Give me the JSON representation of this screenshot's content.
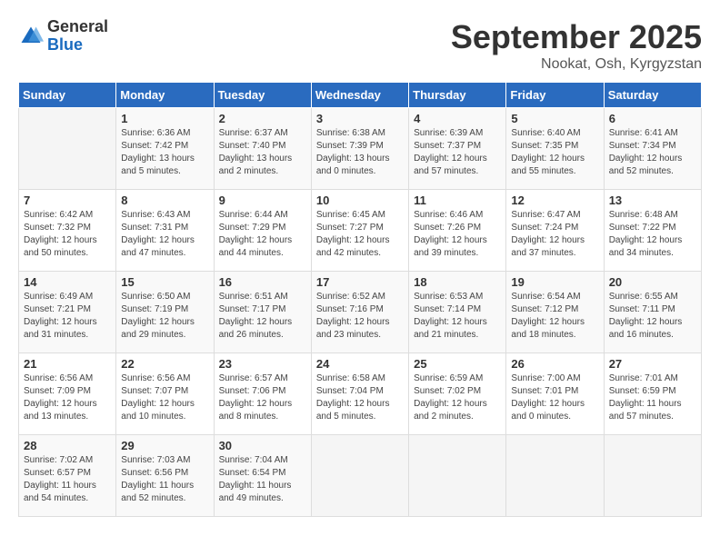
{
  "header": {
    "logo_general": "General",
    "logo_blue": "Blue",
    "month_title": "September 2025",
    "location": "Nookat, Osh, Kyrgyzstan"
  },
  "days_of_week": [
    "Sunday",
    "Monday",
    "Tuesday",
    "Wednesday",
    "Thursday",
    "Friday",
    "Saturday"
  ],
  "weeks": [
    [
      {
        "day": "",
        "sunrise": "",
        "sunset": "",
        "daylight": ""
      },
      {
        "day": "1",
        "sunrise": "Sunrise: 6:36 AM",
        "sunset": "Sunset: 7:42 PM",
        "daylight": "Daylight: 13 hours and 5 minutes."
      },
      {
        "day": "2",
        "sunrise": "Sunrise: 6:37 AM",
        "sunset": "Sunset: 7:40 PM",
        "daylight": "Daylight: 13 hours and 2 minutes."
      },
      {
        "day": "3",
        "sunrise": "Sunrise: 6:38 AM",
        "sunset": "Sunset: 7:39 PM",
        "daylight": "Daylight: 13 hours and 0 minutes."
      },
      {
        "day": "4",
        "sunrise": "Sunrise: 6:39 AM",
        "sunset": "Sunset: 7:37 PM",
        "daylight": "Daylight: 12 hours and 57 minutes."
      },
      {
        "day": "5",
        "sunrise": "Sunrise: 6:40 AM",
        "sunset": "Sunset: 7:35 PM",
        "daylight": "Daylight: 12 hours and 55 minutes."
      },
      {
        "day": "6",
        "sunrise": "Sunrise: 6:41 AM",
        "sunset": "Sunset: 7:34 PM",
        "daylight": "Daylight: 12 hours and 52 minutes."
      }
    ],
    [
      {
        "day": "7",
        "sunrise": "Sunrise: 6:42 AM",
        "sunset": "Sunset: 7:32 PM",
        "daylight": "Daylight: 12 hours and 50 minutes."
      },
      {
        "day": "8",
        "sunrise": "Sunrise: 6:43 AM",
        "sunset": "Sunset: 7:31 PM",
        "daylight": "Daylight: 12 hours and 47 minutes."
      },
      {
        "day": "9",
        "sunrise": "Sunrise: 6:44 AM",
        "sunset": "Sunset: 7:29 PM",
        "daylight": "Daylight: 12 hours and 44 minutes."
      },
      {
        "day": "10",
        "sunrise": "Sunrise: 6:45 AM",
        "sunset": "Sunset: 7:27 PM",
        "daylight": "Daylight: 12 hours and 42 minutes."
      },
      {
        "day": "11",
        "sunrise": "Sunrise: 6:46 AM",
        "sunset": "Sunset: 7:26 PM",
        "daylight": "Daylight: 12 hours and 39 minutes."
      },
      {
        "day": "12",
        "sunrise": "Sunrise: 6:47 AM",
        "sunset": "Sunset: 7:24 PM",
        "daylight": "Daylight: 12 hours and 37 minutes."
      },
      {
        "day": "13",
        "sunrise": "Sunrise: 6:48 AM",
        "sunset": "Sunset: 7:22 PM",
        "daylight": "Daylight: 12 hours and 34 minutes."
      }
    ],
    [
      {
        "day": "14",
        "sunrise": "Sunrise: 6:49 AM",
        "sunset": "Sunset: 7:21 PM",
        "daylight": "Daylight: 12 hours and 31 minutes."
      },
      {
        "day": "15",
        "sunrise": "Sunrise: 6:50 AM",
        "sunset": "Sunset: 7:19 PM",
        "daylight": "Daylight: 12 hours and 29 minutes."
      },
      {
        "day": "16",
        "sunrise": "Sunrise: 6:51 AM",
        "sunset": "Sunset: 7:17 PM",
        "daylight": "Daylight: 12 hours and 26 minutes."
      },
      {
        "day": "17",
        "sunrise": "Sunrise: 6:52 AM",
        "sunset": "Sunset: 7:16 PM",
        "daylight": "Daylight: 12 hours and 23 minutes."
      },
      {
        "day": "18",
        "sunrise": "Sunrise: 6:53 AM",
        "sunset": "Sunset: 7:14 PM",
        "daylight": "Daylight: 12 hours and 21 minutes."
      },
      {
        "day": "19",
        "sunrise": "Sunrise: 6:54 AM",
        "sunset": "Sunset: 7:12 PM",
        "daylight": "Daylight: 12 hours and 18 minutes."
      },
      {
        "day": "20",
        "sunrise": "Sunrise: 6:55 AM",
        "sunset": "Sunset: 7:11 PM",
        "daylight": "Daylight: 12 hours and 16 minutes."
      }
    ],
    [
      {
        "day": "21",
        "sunrise": "Sunrise: 6:56 AM",
        "sunset": "Sunset: 7:09 PM",
        "daylight": "Daylight: 12 hours and 13 minutes."
      },
      {
        "day": "22",
        "sunrise": "Sunrise: 6:56 AM",
        "sunset": "Sunset: 7:07 PM",
        "daylight": "Daylight: 12 hours and 10 minutes."
      },
      {
        "day": "23",
        "sunrise": "Sunrise: 6:57 AM",
        "sunset": "Sunset: 7:06 PM",
        "daylight": "Daylight: 12 hours and 8 minutes."
      },
      {
        "day": "24",
        "sunrise": "Sunrise: 6:58 AM",
        "sunset": "Sunset: 7:04 PM",
        "daylight": "Daylight: 12 hours and 5 minutes."
      },
      {
        "day": "25",
        "sunrise": "Sunrise: 6:59 AM",
        "sunset": "Sunset: 7:02 PM",
        "daylight": "Daylight: 12 hours and 2 minutes."
      },
      {
        "day": "26",
        "sunrise": "Sunrise: 7:00 AM",
        "sunset": "Sunset: 7:01 PM",
        "daylight": "Daylight: 12 hours and 0 minutes."
      },
      {
        "day": "27",
        "sunrise": "Sunrise: 7:01 AM",
        "sunset": "Sunset: 6:59 PM",
        "daylight": "Daylight: 11 hours and 57 minutes."
      }
    ],
    [
      {
        "day": "28",
        "sunrise": "Sunrise: 7:02 AM",
        "sunset": "Sunset: 6:57 PM",
        "daylight": "Daylight: 11 hours and 54 minutes."
      },
      {
        "day": "29",
        "sunrise": "Sunrise: 7:03 AM",
        "sunset": "Sunset: 6:56 PM",
        "daylight": "Daylight: 11 hours and 52 minutes."
      },
      {
        "day": "30",
        "sunrise": "Sunrise: 7:04 AM",
        "sunset": "Sunset: 6:54 PM",
        "daylight": "Daylight: 11 hours and 49 minutes."
      },
      {
        "day": "",
        "sunrise": "",
        "sunset": "",
        "daylight": ""
      },
      {
        "day": "",
        "sunrise": "",
        "sunset": "",
        "daylight": ""
      },
      {
        "day": "",
        "sunrise": "",
        "sunset": "",
        "daylight": ""
      },
      {
        "day": "",
        "sunrise": "",
        "sunset": "",
        "daylight": ""
      }
    ]
  ]
}
